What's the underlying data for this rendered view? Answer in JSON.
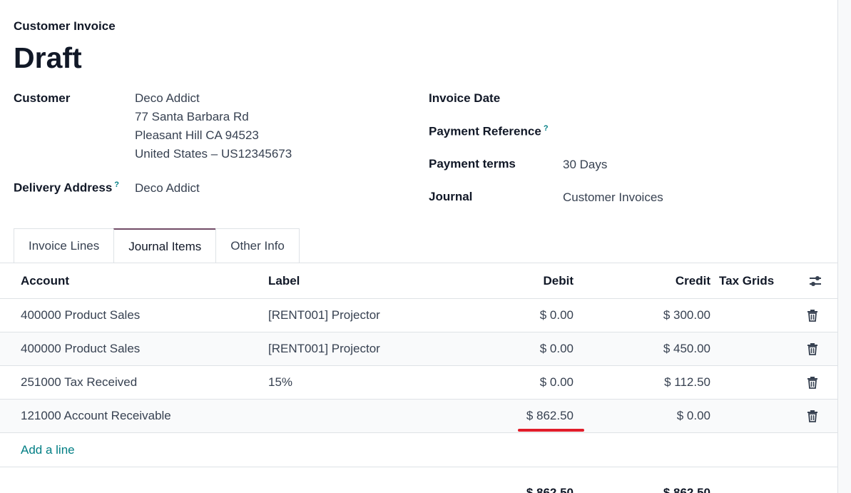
{
  "header": {
    "doc_type": "Customer Invoice",
    "state": "Draft"
  },
  "form": {
    "customer_label": "Customer",
    "customer_name": "Deco Addict",
    "customer_address": [
      "77 Santa Barbara Rd",
      "Pleasant Hill CA 94523",
      "United States – US12345673"
    ],
    "delivery_label": "Delivery Address",
    "delivery_help": "?",
    "delivery_value": "Deco Addict",
    "invoice_date_label": "Invoice Date",
    "payment_ref_label": "Payment Reference",
    "payment_ref_help": "?",
    "payment_terms_label": "Payment terms",
    "payment_terms_value": "30 Days",
    "journal_label": "Journal",
    "journal_value": "Customer Invoices"
  },
  "tabs": [
    {
      "label": "Invoice Lines",
      "active": false
    },
    {
      "label": "Journal Items",
      "active": true
    },
    {
      "label": "Other Info",
      "active": false
    }
  ],
  "table": {
    "columns": {
      "account": "Account",
      "label": "Label",
      "debit": "Debit",
      "credit": "Credit",
      "tax_grids": "Tax Grids"
    },
    "rows": [
      {
        "account": "400000 Product Sales",
        "label": "[RENT001] Projector",
        "debit": "$ 0.00",
        "credit": "$ 300.00"
      },
      {
        "account": "400000 Product Sales",
        "label": "[RENT001] Projector",
        "debit": "$ 0.00",
        "credit": "$ 450.00"
      },
      {
        "account": "251000 Tax Received",
        "label": "15%",
        "debit": "$ 0.00",
        "credit": "$ 112.50"
      },
      {
        "account": "121000 Account Receivable",
        "label": "",
        "debit": "$ 862.50",
        "credit": "$ 0.00"
      }
    ],
    "add_line": "Add a line",
    "totals": {
      "debit": "$ 862.50",
      "credit": "$ 862.50"
    }
  },
  "icons": {
    "optional_columns": "sliders-icon",
    "delete": "trash-icon"
  },
  "colors": {
    "link": "#017e84",
    "highlight": "#e11d2a",
    "active_tab": "#714b67"
  }
}
